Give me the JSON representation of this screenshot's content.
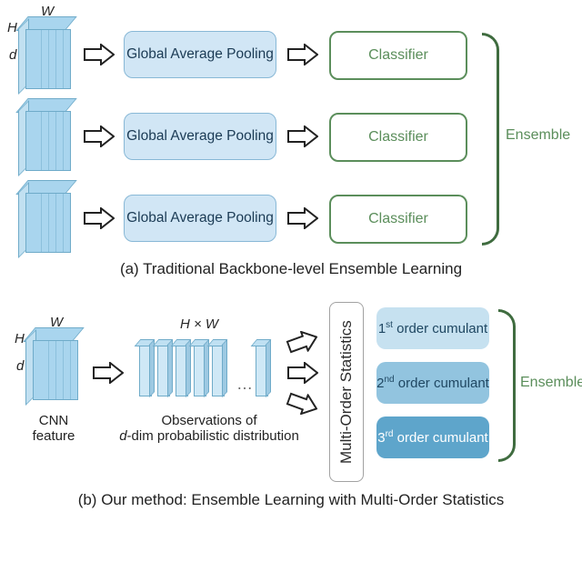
{
  "dims": {
    "W": "W",
    "H": "H",
    "d": "d",
    "HxW": "H × W"
  },
  "gap_label": "Global Average Pooling",
  "classifier_label": "Classifier",
  "ensemble_label": "Ensemble",
  "caption_a": "(a) Traditional Backbone-level Ensemble Learning",
  "caption_b": "(b) Our method: Ensemble Learning with Multi-Order Statistics",
  "labels": {
    "cnn_feature": "CNN feature",
    "observations_l1": "Observations of",
    "observations_l2_pre": "d",
    "observations_l2_post": "-dim probabilistic distribution",
    "mos": "Multi-Order Statistics"
  },
  "cumulants": {
    "c1": {
      "ord": "1",
      "suf": "st",
      "word": "order cumulant"
    },
    "c2": {
      "ord": "2",
      "suf": "nd",
      "word": "order cumulant"
    },
    "c3": {
      "ord": "3",
      "suf": "rd",
      "word": "order cumulant"
    }
  }
}
